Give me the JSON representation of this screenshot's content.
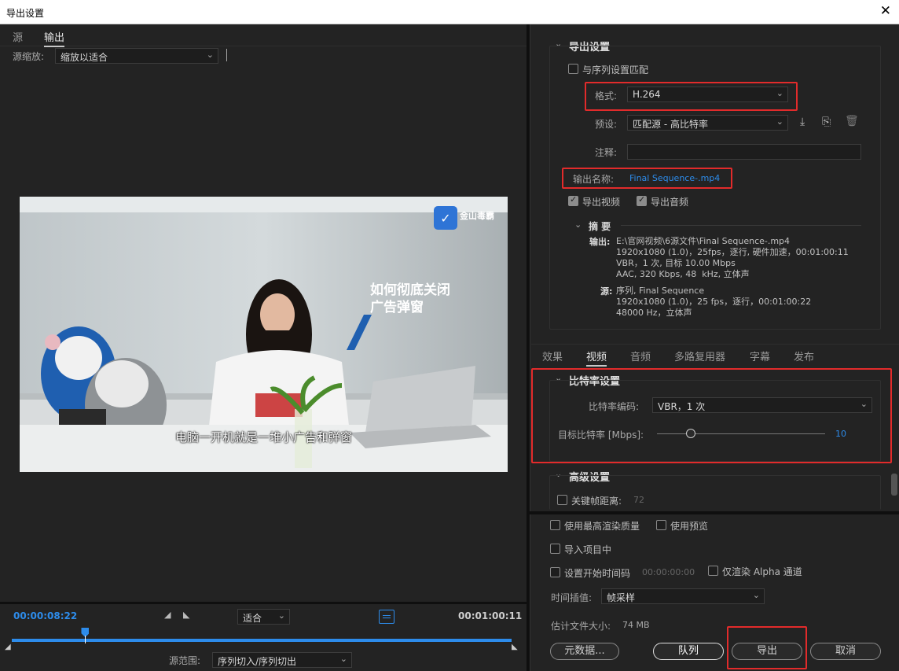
{
  "window": {
    "title": "导出设置",
    "close": "✕"
  },
  "left": {
    "tabs": [
      "源",
      "输出"
    ],
    "zoom_label": "源缩放:",
    "zoom_value": "缩放以适合",
    "video_title": "如何彻底关闭\n广告弹窗",
    "video_title_line1": "如何彻底关闭",
    "video_title_line2": "广告弹窗",
    "subtitle": "电脑一开机就是一堆小广告和弹窗",
    "logo_text": "金山毒霸",
    "timecode_current": "00:00:08:22",
    "timecode_end": "00:01:00:11",
    "fit_value": "适合",
    "range_label": "源范围:",
    "range_value": "序列切入/序列切出",
    "playhead_fraction": 0.147
  },
  "export": {
    "section": "导出设置",
    "match_sequence": "与序列设置匹配",
    "format_label": "格式:",
    "format_value": "H.264",
    "preset_label": "预设:",
    "preset_value": "匹配源 - 高比特率",
    "comment_label": "注释:",
    "output_name_label": "输出名称:",
    "output_name_value": "Final Sequence-.mp4",
    "export_video": "导出视频",
    "export_audio": "导出音频",
    "summary_label": "摘 要",
    "output_key": "输出:",
    "output_lines": [
      "E:\\官网视频\\6源文件\\Final Sequence-.mp4",
      "1920x1080 (1.0)，25fps，逐行, 硬件加速，00:01:00:11",
      "VBR，1 次, 目标 10.00 Mbps",
      "AAC, 320 Kbps, 48  kHz, 立体声"
    ],
    "source_key": "源:",
    "source_lines": [
      "序列, Final Sequence",
      "1920x1080 (1.0)，25 fps，逐行，00:01:00:22",
      "48000 Hz，立体声"
    ]
  },
  "tabs": [
    "效果",
    "视频",
    "音频",
    "多路复用器",
    "字幕",
    "发布"
  ],
  "bitrate": {
    "section": "比特率设置",
    "encoding_label": "比特率编码:",
    "encoding_value": "VBR，1 次",
    "target_label": "目标比特率 [Mbps]:",
    "target_value": "10",
    "slider_fraction": 0.2
  },
  "advanced": {
    "section": "高级设置",
    "keyframe_label": "关键帧距离:",
    "keyframe_value": "72"
  },
  "options": {
    "max_quality": "使用最高渲染质量",
    "use_preview": "使用预览",
    "import_project": "导入项目中",
    "set_start_tc": "设置开始时间码",
    "start_tc_value": "00:00:00:00",
    "alpha_only": "仅渲染 Alpha 通道",
    "interp_label": "时间插值:",
    "interp_value": "帧采样",
    "filesize_label": "估计文件大小:",
    "filesize_value": "74 MB"
  },
  "buttons": {
    "metadata": "元数据...",
    "queue": "队列",
    "export": "导出",
    "cancel": "取消"
  },
  "colors": {
    "accent": "#2d8ceb",
    "highlight": "#e22b2b"
  }
}
